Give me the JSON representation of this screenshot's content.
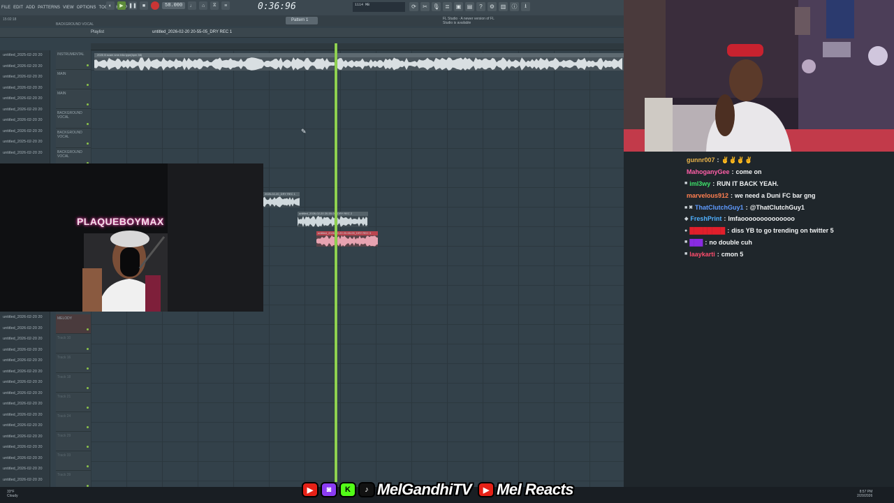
{
  "daw": {
    "menu": [
      "FILE",
      "EDIT",
      "ADD",
      "PATTERNS",
      "VIEW",
      "OPTIONS",
      "TOOLS",
      "HELP"
    ],
    "tempo": "58.000",
    "timecode": "0:36:96",
    "cpu": "1114 MB",
    "pattern": "Pattern 1",
    "news": "FL Studio · A newer version of FL Studio is available",
    "playlist_title": "Playlist",
    "file_name": "untitled_2026-02-20 20-55-05_DRY REC 1",
    "tab_session": "BACKGROUND VOCAL",
    "session_time": "15:02:18",
    "instrumental_clip_label": "2026 lil scam smn trila type(bpm 58)",
    "clips": [
      {
        "label": "2026-02-20_DRY REC 1"
      },
      {
        "label": "untitled_2026-02-20 20-55-05_DRY REC 2"
      },
      {
        "label": "untitled_2026-02-20 20-55-05_DRY REC 3"
      }
    ],
    "tracks_top": [
      "INSTRUMENTAL",
      "MAIN",
      "MAIN",
      "BACKGROUND VOCAL",
      "BACKGROUND VOCAL",
      "BACKGROUND VOCAL"
    ],
    "tracks_bottom": [
      "MELODY",
      "Track 10",
      "Track 16",
      "Track 18",
      "Track 21",
      "Track 24",
      "Track 29",
      "Track 33",
      "Track 39"
    ],
    "browser_items": [
      "untitled_2025-02-20 20",
      "untitled_2026-02-20 20",
      "untitled_2026-02-20 20",
      "untitled_2026-02-20 20",
      "untitled_2026-02-20 20",
      "untitled_2026-02-20 20",
      "untitled_2026-02-20 20",
      "untitled_2026-02-20 20",
      "untitled_2025-02-20 20",
      "untitled_2026-02-20 20",
      "untitled_2026-02-20 20",
      "untitled_2026-02-20 20",
      "untitled_2026-02-20 20",
      "untitled_2026-02-20 20",
      "untitled_2026-02-20 20",
      "untitled_2026-02-20 20",
      "untitled_2026-02-20 20",
      "untitled_2026-02-20 20",
      "untitled_2026-02-20 20",
      "untitled_2026-02-20 20",
      "untitled_2026-02-20 20",
      "untitled_2026-02-20 20",
      "untitled_2026-02-20 20",
      "untitled_2026-02-20 20",
      "untitled_2026-02-20 20",
      "untitled_2026-02-20 20",
      "untitled_2026-02-20 20"
    ]
  },
  "overlay": {
    "artist_name": "PLAQUEBOYMAX"
  },
  "chat": [
    {
      "badge": "",
      "user": "gunnr007",
      "color": "#e8b34a",
      "msg": "✌✌✌✌"
    },
    {
      "badge": "",
      "user": "MahoganyGee",
      "color": "#ff5fa8",
      "msg": "come on"
    },
    {
      "badge": "■",
      "user": "iml3wy",
      "color": "#3ee06a",
      "msg": "RUN IT BACK YEAH."
    },
    {
      "badge": "",
      "user": "marvelous912",
      "color": "#ff7f50",
      "msg": "we need a Duni FC bar gng"
    },
    {
      "badge": "■ ✖",
      "user": "ThatClutchGuy1",
      "color": "#5f9bff",
      "msg": "@ThatClutchGuy1"
    },
    {
      "badge": "◆",
      "user": "FreshPrint",
      "color": "#4fb0ff",
      "msg": "lmfaoooooooooooooo"
    },
    {
      "badge": "●",
      "user": "████████",
      "color": "#e01f2b",
      "msg": "diss YB to go trending on twitter 5"
    },
    {
      "badge": "■",
      "user": "███",
      "color": "#8a2be2",
      "msg": "no double cuh"
    },
    {
      "badge": "■",
      "user": "laaykarti",
      "color": "#ff4d6d",
      "msg": "cmon 5"
    }
  ],
  "banner": {
    "channel1": "MelGandhiTV",
    "channel2": "Mel Reacts"
  },
  "taskbar": {
    "weather_temp": "33°F",
    "weather_desc": "Cloudy",
    "time": "8:57 PM",
    "date": "2/20/2026"
  },
  "colors": {
    "playhead": "#a6e05c",
    "record": "#c93535",
    "daw_bg": "#33414a"
  }
}
